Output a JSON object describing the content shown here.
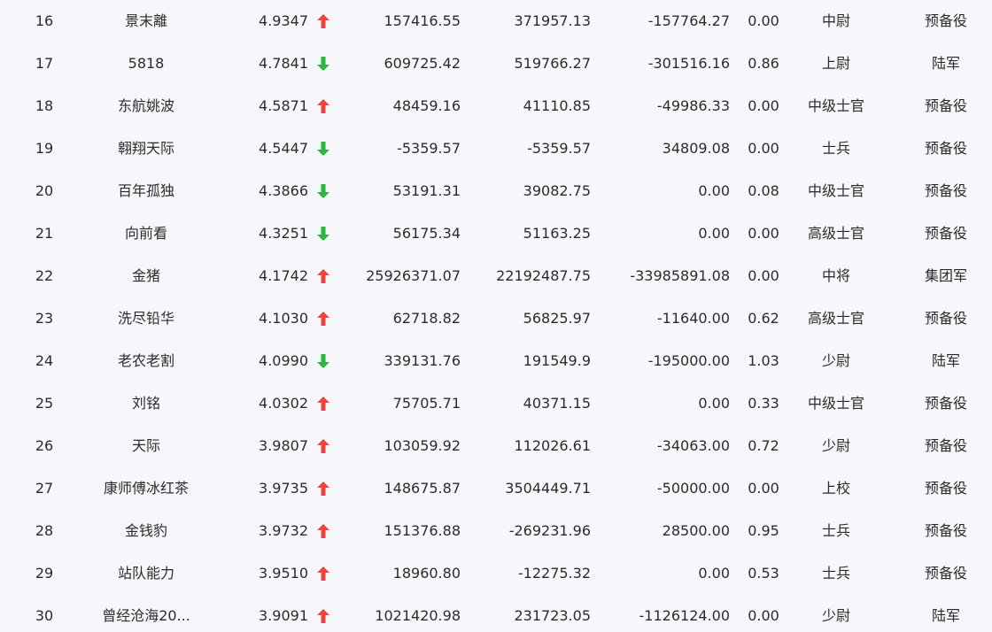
{
  "colors": {
    "up": "#e8453c",
    "down": "#2fb344",
    "background": "#f6f7fb",
    "text": "#2b2b2b"
  },
  "rows": [
    {
      "rank": "16",
      "name": "景末離",
      "score": "4.9347",
      "trend": "up",
      "trend_icon": "arrow-up-icon",
      "v1": "157416.55",
      "v2": "371957.13",
      "v3": "-157764.27",
      "ratio": "0.00",
      "title": "中尉",
      "unit": "预备役"
    },
    {
      "rank": "17",
      "name": "5818",
      "score": "4.7841",
      "trend": "down",
      "trend_icon": "arrow-down-icon",
      "v1": "609725.42",
      "v2": "519766.27",
      "v3": "-301516.16",
      "ratio": "0.86",
      "title": "上尉",
      "unit": "陆军"
    },
    {
      "rank": "18",
      "name": "东航姚波",
      "score": "4.5871",
      "trend": "up",
      "trend_icon": "arrow-up-icon",
      "v1": "48459.16",
      "v2": "41110.85",
      "v3": "-49986.33",
      "ratio": "0.00",
      "title": "中级士官",
      "unit": "预备役"
    },
    {
      "rank": "19",
      "name": "翱翔天际",
      "score": "4.5447",
      "trend": "down",
      "trend_icon": "arrow-down-icon",
      "v1": "-5359.57",
      "v2": "-5359.57",
      "v3": "34809.08",
      "ratio": "0.00",
      "title": "士兵",
      "unit": "预备役"
    },
    {
      "rank": "20",
      "name": "百年孤独",
      "score": "4.3866",
      "trend": "down",
      "trend_icon": "arrow-down-icon",
      "v1": "53191.31",
      "v2": "39082.75",
      "v3": "0.00",
      "ratio": "0.08",
      "title": "中级士官",
      "unit": "预备役"
    },
    {
      "rank": "21",
      "name": "向前看",
      "score": "4.3251",
      "trend": "down",
      "trend_icon": "arrow-down-icon",
      "v1": "56175.34",
      "v2": "51163.25",
      "v3": "0.00",
      "ratio": "0.00",
      "title": "高级士官",
      "unit": "预备役"
    },
    {
      "rank": "22",
      "name": "金猪",
      "score": "4.1742",
      "trend": "up",
      "trend_icon": "arrow-up-icon",
      "v1": "25926371.07",
      "v2": "22192487.75",
      "v3": "-33985891.08",
      "ratio": "0.00",
      "title": "中将",
      "unit": "集团军"
    },
    {
      "rank": "23",
      "name": "洗尽铅华",
      "score": "4.1030",
      "trend": "up",
      "trend_icon": "arrow-up-icon",
      "v1": "62718.82",
      "v2": "56825.97",
      "v3": "-11640.00",
      "ratio": "0.62",
      "title": "高级士官",
      "unit": "预备役"
    },
    {
      "rank": "24",
      "name": "老农老割",
      "score": "4.0990",
      "trend": "down",
      "trend_icon": "arrow-down-icon",
      "v1": "339131.76",
      "v2": "191549.9",
      "v3": "-195000.00",
      "ratio": "1.03",
      "title": "少尉",
      "unit": "陆军"
    },
    {
      "rank": "25",
      "name": "刘铭",
      "score": "4.0302",
      "trend": "up",
      "trend_icon": "arrow-up-icon",
      "v1": "75705.71",
      "v2": "40371.15",
      "v3": "0.00",
      "ratio": "0.33",
      "title": "中级士官",
      "unit": "预备役"
    },
    {
      "rank": "26",
      "name": "天际",
      "score": "3.9807",
      "trend": "up",
      "trend_icon": "arrow-up-icon",
      "v1": "103059.92",
      "v2": "112026.61",
      "v3": "-34063.00",
      "ratio": "0.72",
      "title": "少尉",
      "unit": "预备役"
    },
    {
      "rank": "27",
      "name": "康师傅冰红茶",
      "score": "3.9735",
      "trend": "up",
      "trend_icon": "arrow-up-icon",
      "v1": "148675.87",
      "v2": "3504449.71",
      "v3": "-50000.00",
      "ratio": "0.00",
      "title": "上校",
      "unit": "预备役"
    },
    {
      "rank": "28",
      "name": "金钱豹",
      "score": "3.9732",
      "trend": "up",
      "trend_icon": "arrow-up-icon",
      "v1": "151376.88",
      "v2": "-269231.96",
      "v3": "28500.00",
      "ratio": "0.95",
      "title": "士兵",
      "unit": "预备役"
    },
    {
      "rank": "29",
      "name": "站队能力",
      "score": "3.9510",
      "trend": "up",
      "trend_icon": "arrow-up-icon",
      "v1": "18960.80",
      "v2": "-12275.32",
      "v3": "0.00",
      "ratio": "0.53",
      "title": "士兵",
      "unit": "预备役"
    },
    {
      "rank": "30",
      "name": "曾经沧海20...",
      "score": "3.9091",
      "trend": "up",
      "trend_icon": "arrow-up-icon",
      "v1": "1021420.98",
      "v2": "231723.05",
      "v3": "-1126124.00",
      "ratio": "0.00",
      "title": "少尉",
      "unit": "陆军"
    }
  ]
}
